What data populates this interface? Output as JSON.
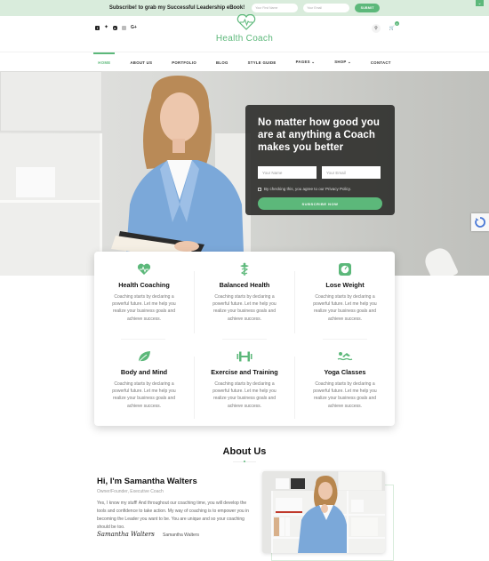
{
  "topbar": {
    "message": "Subscribe! to grab my Successful Leadership eBook!",
    "first_name_placeholder": "Your First Name",
    "email_placeholder": "Your Email",
    "submit_label": "SUBMIT",
    "close_icon": "chevron-down-icon"
  },
  "header": {
    "brand": "Health Coach",
    "logo_icon": "heart-pulse-icon",
    "social": [
      "facebook-icon",
      "twitter-icon",
      "youtube-icon",
      "instagram-icon",
      "google-plus-icon"
    ],
    "google_plus_label": "G+",
    "cart_count": "0"
  },
  "nav": {
    "items": [
      {
        "label": "HOME",
        "active": true
      },
      {
        "label": "ABOUT US"
      },
      {
        "label": "PORTFOLIO"
      },
      {
        "label": "BLOG"
      },
      {
        "label": "STYLE GUIDE"
      },
      {
        "label": "PAGES ⌄"
      },
      {
        "label": "SHOP ⌄"
      },
      {
        "label": "CONTACT"
      }
    ]
  },
  "hero": {
    "headline": "No matter how good you are at anything a Coach makes you better",
    "name_placeholder": "Your Name",
    "email_placeholder": "Your Email",
    "consent": "By checking this, you agree to our Privacy Policy.",
    "cta": "SUBSCRIBE NOW"
  },
  "services": [
    {
      "title": "Health Coaching",
      "icon": "heart-pulse-icon",
      "text": "Coaching starts by declaring a powerful future. Let me help you realize your business goals and achieve success."
    },
    {
      "title": "Balanced Health",
      "icon": "caduceus-icon",
      "text": "Coaching starts by declaring a powerful future. Let me help you realize your business goals and achieve success."
    },
    {
      "title": "Lose Weight",
      "icon": "scale-icon",
      "text": "Coaching starts by declaring a powerful future. Let me help you realize your business goals and achieve success."
    },
    {
      "title": "Body and Mind",
      "icon": "leaf-icon",
      "text": "Coaching starts by declaring a powerful future. Let me help you realize your business goals and achieve success."
    },
    {
      "title": "Exercise and Training",
      "icon": "dumbbell-icon",
      "text": "Coaching starts by declaring a powerful future. Let me help you realize your business goals and achieve success."
    },
    {
      "title": "Yoga Classes",
      "icon": "swimmer-icon",
      "text": "Coaching starts by declaring a powerful future. Let me help you realize your business goals and achieve success."
    }
  ],
  "about": {
    "title": "About Us",
    "greeting": "Hi, I'm Samantha Walters",
    "role": "Owner/Founder, Executive Coach",
    "bio": "Yes, I know my stuff! And throughout our coaching time, you will develop the tools and confidence to take action. My way of coaching is to empower you in becoming the Leader you want to be. You are unique and so your coaching should be too.",
    "signature": "Samantha Walters",
    "signature_name": "Samantha Walters"
  },
  "colors": {
    "accent": "#5cb87a",
    "topbar_bg": "#d9ecdc",
    "optin_bg": "#282826"
  }
}
